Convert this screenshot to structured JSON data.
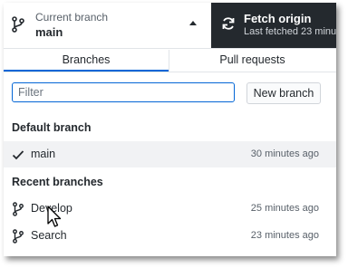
{
  "header": {
    "current_branch_label": "Current branch",
    "current_branch_value": "main",
    "fetch_title": "Fetch origin",
    "fetch_subtitle": "Last fetched 23 minu"
  },
  "tabs": [
    {
      "label": "Branches",
      "active": true
    },
    {
      "label": "Pull requests",
      "active": false
    }
  ],
  "filter": {
    "placeholder": "Filter",
    "value": ""
  },
  "new_branch_label": "New branch",
  "sections": {
    "default_title": "Default branch",
    "recent_title": "Recent branches"
  },
  "default_branches": [
    {
      "name": "main",
      "time": "30 minutes ago",
      "icon": "check-icon"
    }
  ],
  "recent_branches": [
    {
      "name": "Develop",
      "time": "25 minutes ago",
      "icon": "branch-icon"
    },
    {
      "name": "Search",
      "time": "23 minutes ago",
      "icon": "branch-icon"
    }
  ],
  "colors": {
    "accent": "#0366d6",
    "dark_button": "#24292e",
    "selected_row": "#f1f2f4"
  }
}
